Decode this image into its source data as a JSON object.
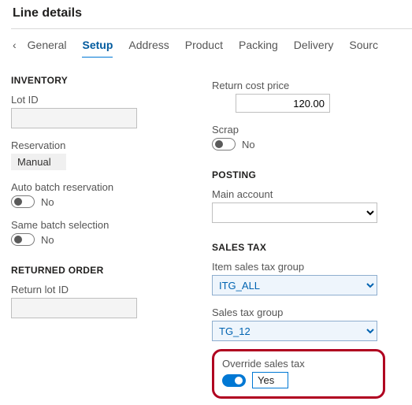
{
  "pageTitle": "Line details",
  "tabs": {
    "chevron": "‹",
    "items": [
      {
        "label": "General",
        "active": false
      },
      {
        "label": "Setup",
        "active": true
      },
      {
        "label": "Address",
        "active": false
      },
      {
        "label": "Product",
        "active": false
      },
      {
        "label": "Packing",
        "active": false
      },
      {
        "label": "Delivery",
        "active": false
      },
      {
        "label": "Sourc",
        "active": false
      }
    ]
  },
  "left": {
    "inventory": {
      "heading": "INVENTORY",
      "lotId": {
        "label": "Lot ID",
        "value": ""
      },
      "reservation": {
        "label": "Reservation",
        "value": "Manual"
      },
      "autoBatch": {
        "label": "Auto batch reservation",
        "value": "No"
      },
      "sameBatch": {
        "label": "Same batch selection",
        "value": "No"
      }
    },
    "returnedOrder": {
      "heading": "RETURNED ORDER",
      "returnLotId": {
        "label": "Return lot ID",
        "value": ""
      }
    }
  },
  "right": {
    "returnCost": {
      "label": "Return cost price",
      "value": "120.00"
    },
    "scrap": {
      "label": "Scrap",
      "value": "No"
    },
    "posting": {
      "heading": "POSTING",
      "mainAccount": {
        "label": "Main account",
        "value": ""
      }
    },
    "salesTax": {
      "heading": "SALES TAX",
      "itemGroup": {
        "label": "Item sales tax group",
        "value": "ITG_ALL"
      },
      "group": {
        "label": "Sales tax group",
        "value": "TG_12"
      },
      "override": {
        "label": "Override sales tax",
        "value": "Yes"
      }
    }
  }
}
